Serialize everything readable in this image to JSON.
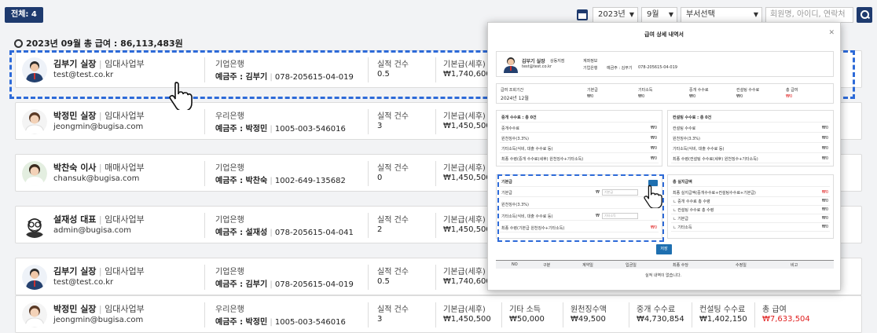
{
  "toolbar": {
    "total_label": "전체: 4",
    "year": "2023년",
    "month": "9월",
    "dept": "부서선택",
    "search_placeholder": "회원명, 아이디, 연락처"
  },
  "summary": "2023년 09월 총 급여 : 86,113,483원",
  "columns": {
    "bank": "",
    "perf": "실적 건수",
    "base": "기본급(세후)"
  },
  "rows": [
    {
      "name": "김부기 실장",
      "role": "임대사업부",
      "email": "test@test.co.kr",
      "bank": "기업은행",
      "holder": "예금주 : 김부기",
      "account": "078-205615-04-019",
      "perf": "0.5",
      "base": "₩1,740,600"
    },
    {
      "name": "박정민 실장",
      "role": "임대사업부",
      "email": "jeongmin@bugisa.com",
      "bank": "우리은행",
      "holder": "예금주 : 박정민",
      "account": "1005-003-546016",
      "perf": "3",
      "base": "₩1,450,500"
    },
    {
      "name": "박찬숙 이사",
      "role": "매매사업부",
      "email": "chansuk@bugisa.com",
      "bank": "기업은행",
      "holder": "예금주 : 박찬숙",
      "account": "1002-649-135682",
      "perf": "0",
      "base": "₩1,450,500"
    },
    {
      "name": "설재성 대표",
      "role": "임대사업부",
      "email": "admin@bugisa.com",
      "bank": "기업은행",
      "holder": "예금주 : 설재성",
      "account": "078-205615-04-041",
      "perf": "2",
      "base": "₩1,450,500"
    },
    {
      "name": "김부기 실장",
      "role": "임대사업부",
      "email": "test@test.co.kr",
      "bank": "기업은행",
      "holder": "예금주 : 김부기",
      "account": "078-205615-04-019",
      "perf": "0.5",
      "base": "₩1,740,600"
    },
    {
      "name": "박정민 실장",
      "role": "임대사업부",
      "email": "jeongmin@bugisa.com",
      "bank": "우리은행",
      "holder": "예금주 : 박정민",
      "account": "1005-003-546016",
      "perf": "3",
      "base": "₩1,450,500"
    }
  ],
  "last_row_extra": {
    "labels": [
      "기타 소득",
      "원천징수액",
      "중개 수수료",
      "컨설팅 수수료",
      "총 급여"
    ],
    "values": [
      "₩50,000",
      "₩49,500",
      "₩4,730,854",
      "₩1,402,150",
      "₩7,633,504"
    ]
  },
  "modal": {
    "title": "급여 상세 내역서",
    "profile": {
      "name": "김부기 실장",
      "dept": "상동지점",
      "email": "test@test.co.kr",
      "acct_label": "계좌정보",
      "bank": "기업은행",
      "holder": "예금주 : 김부기",
      "account": "078-205615-04-019"
    },
    "period": {
      "label": "급여 조회기간",
      "value": "2024년 12월"
    },
    "stats": [
      {
        "label": "기본급",
        "value": "₩0"
      },
      {
        "label": "기타소득",
        "value": "₩0"
      },
      {
        "label": "중개 수수료",
        "value": "₩0"
      },
      {
        "label": "컨설팅 수수료",
        "value": "₩0"
      },
      {
        "label": "총 급여",
        "value": "₩0"
      }
    ],
    "broker": {
      "title": "중개 수수료 : 총 0건",
      "rows": [
        {
          "label": "중개수수료",
          "value": "₩0"
        },
        {
          "label": "원천징수(3.3%)",
          "value": "₩0"
        },
        {
          "label": "기타소득(식비, 대출 수수료 등)",
          "value": "₩0"
        },
        {
          "label": "최종 수령(중개 수수료(세후) 원천징수+기타소득)",
          "value": "₩0"
        }
      ]
    },
    "consult": {
      "title": "컨설팅 수수료 : 총 0건",
      "rows": [
        {
          "label": "컨설팅 수수료",
          "value": "₩0"
        },
        {
          "label": "원천징수(3.3%)",
          "value": "₩0"
        },
        {
          "label": "기타소득(식비, 대출 수수료 등)",
          "value": "₩0"
        },
        {
          "label": "최종 수령(컨설팅 수수료(세후) 원천징수+기타소득)",
          "value": "₩0"
        }
      ]
    },
    "base": {
      "title": "기본급",
      "rows": [
        {
          "label": "기본급",
          "value": "₩",
          "placeholder": "기본급"
        },
        {
          "label": "원천징수(3.3%)",
          "value": ""
        },
        {
          "label": "기타소득(식비, 대출 수수료 등)",
          "value": "₩",
          "placeholder": "기타소득"
        },
        {
          "label": "최종 수령(기본급 원천징수+기타소득)",
          "value": "₩0"
        }
      ]
    },
    "total": {
      "title": "총 실지급액",
      "rows": [
        {
          "label": "최종 실지급액(중개수수료+컨설팅수수료+기본급)",
          "value": "₩0"
        },
        {
          "label": "ㄴ 중개 수수료 총 수령",
          "value": "₩0"
        },
        {
          "label": "ㄴ 컨설팅 수수료 총 수령",
          "value": "₩0"
        },
        {
          "label": "ㄴ 기본급",
          "value": "₩0"
        },
        {
          "label": "ㄴ 기타소득",
          "value": "₩0"
        }
      ]
    },
    "save": "저장",
    "table_headers": [
      "NO",
      "구분",
      "계약일",
      "입금일",
      "최종 수당",
      "수정일",
      "비고"
    ],
    "empty": "실적 내역이 없습니다."
  },
  "colors": {
    "navy": "#1e3a6e",
    "accent": "#2d6ad8",
    "red": "#e02020"
  }
}
